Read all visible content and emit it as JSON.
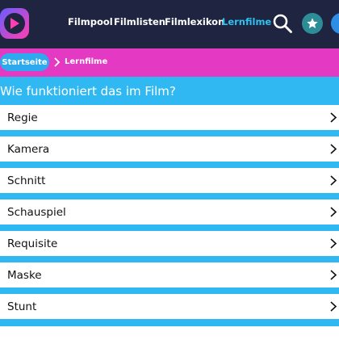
{
  "nav": {
    "items": [
      "Filmpool",
      "Filmlisten",
      "Filmlexikon",
      "Lernfilme"
    ],
    "active": "Lernfilme"
  },
  "header_icons": [
    "search-icon",
    "star-icon",
    "profile-icon"
  ],
  "breadcrumb": {
    "home": "Startseite",
    "current": "Lernfilme"
  },
  "section": {
    "heading": "Wie funktioniert das im Film?",
    "items": [
      "Regie",
      "Kamera",
      "Schnitt",
      "Schauspiel",
      "Requisite",
      "Maske",
      "Stunt"
    ]
  },
  "colors": {
    "topbar": "#1f2440",
    "breadcrumb_bar": "#e43ac3",
    "list_background": "#2fb8f2",
    "active_nav": "#2ec1f2"
  }
}
